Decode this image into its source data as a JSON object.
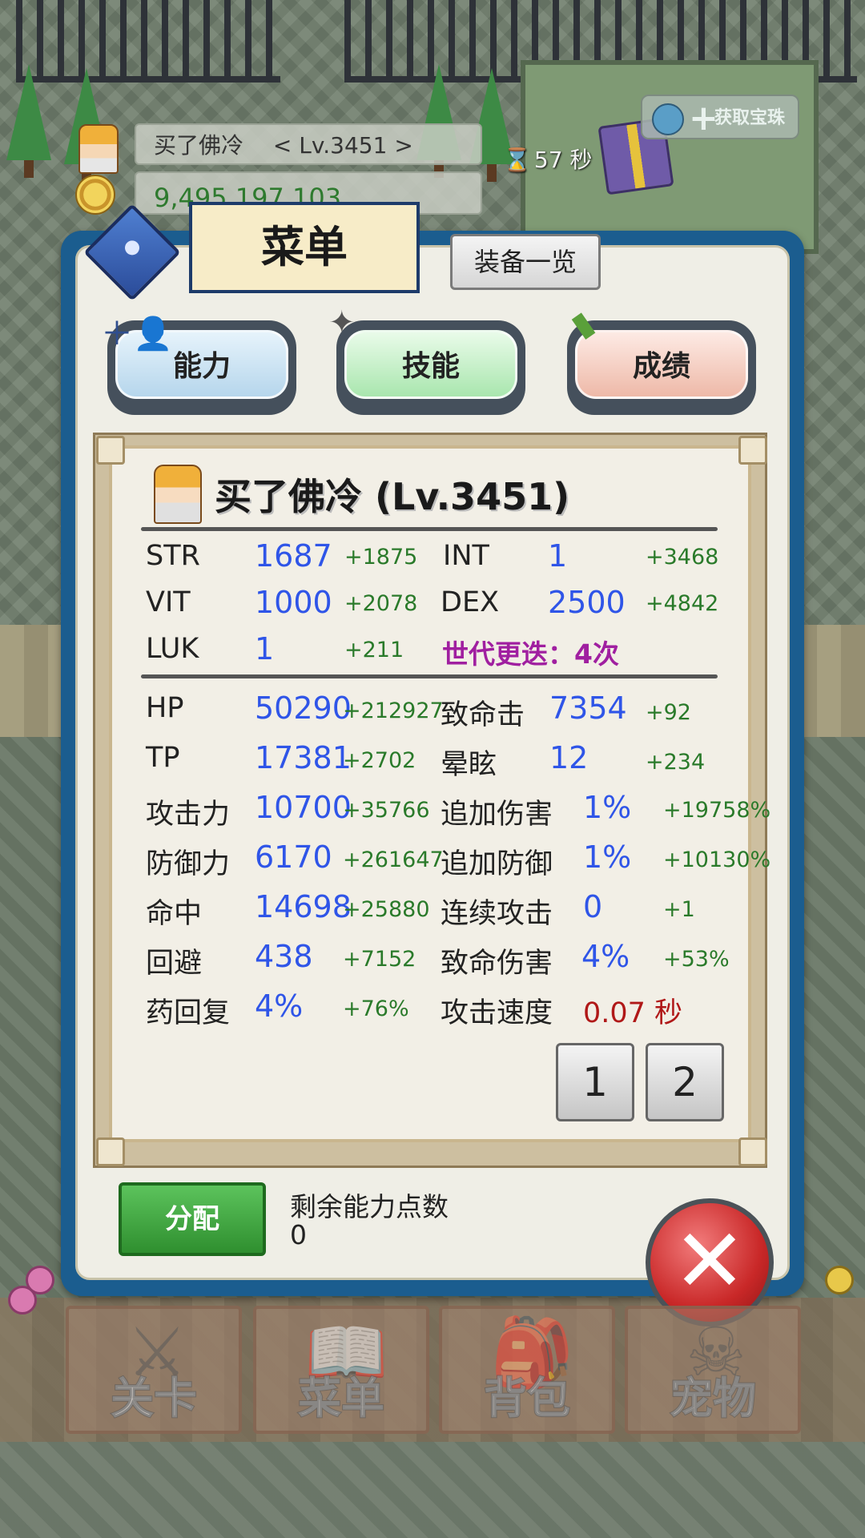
{
  "hud": {
    "player_name": "买了佛冷",
    "player_level": "< Lv.3451 >",
    "gold": "9,495,197,103",
    "timer_value": "57 秒",
    "get_orb_label": "获取宝珠"
  },
  "menu": {
    "title": "菜单",
    "equip_list_label": "装备一览",
    "tabs": [
      {
        "label": "能力"
      },
      {
        "label": "技能"
      },
      {
        "label": "成绩"
      }
    ]
  },
  "character": {
    "title": "买了佛冷 (Lv.3451)"
  },
  "base_stats": [
    {
      "label": "STR",
      "value": "1687",
      "bonus": "+1875"
    },
    {
      "label": "INT",
      "value": "1",
      "bonus": "+3468"
    },
    {
      "label": "VIT",
      "value": "1000",
      "bonus": "+2078"
    },
    {
      "label": "DEX",
      "value": "2500",
      "bonus": "+4842"
    },
    {
      "label": "LUK",
      "value": "1",
      "bonus": "+211"
    }
  ],
  "generation": "世代更迭：4次",
  "combat_stats_left": [
    {
      "label": "HP",
      "value": "50290",
      "bonus": "+212927"
    },
    {
      "label": "TP",
      "value": "17381",
      "bonus": "+2702"
    },
    {
      "label": "攻击力",
      "value": "10700",
      "bonus": "+35766"
    },
    {
      "label": "防御力",
      "value": "6170",
      "bonus": "+261647"
    },
    {
      "label": "命中",
      "value": "14698",
      "bonus": "+25880"
    },
    {
      "label": "回避",
      "value": "438",
      "bonus": "+7152"
    },
    {
      "label": "药回复",
      "value": "4%",
      "bonus": "+76%"
    }
  ],
  "combat_stats_right": [
    {
      "label": "致命击",
      "value": "7354",
      "bonus": "+92"
    },
    {
      "label": "晕眩",
      "value": "12",
      "bonus": "+234"
    },
    {
      "label": "追加伤害",
      "value": "1%",
      "bonus": "+19758%"
    },
    {
      "label": "追加防御",
      "value": "1%",
      "bonus": "+10130%"
    },
    {
      "label": "连续攻击",
      "value": "0",
      "bonus": "+1"
    },
    {
      "label": "致命伤害",
      "value": "4%",
      "bonus": "+53%"
    },
    {
      "label": "攻击速度",
      "value": "0.07 秒",
      "bonus": ""
    }
  ],
  "pages": [
    "1",
    "2"
  ],
  "points": {
    "assign_label": "分配",
    "remaining_label": "剩余能力点数",
    "remaining_value": "0"
  },
  "nav": [
    {
      "label": "关卡",
      "icon": "crossed-swords-icon"
    },
    {
      "label": "菜单",
      "icon": "book-icon"
    },
    {
      "label": "背包",
      "icon": "backpack-icon"
    },
    {
      "label": "宠物",
      "icon": "skull-icon"
    }
  ],
  "colors": {
    "panel_border": "#1b5d8f",
    "stat_value": "#2f55e8",
    "stat_bonus": "#2a7a2a",
    "generation": "#a01fa0",
    "attack_speed": "#b01818",
    "assign_button": "#2f8f2f",
    "close_button": "#c92828"
  }
}
